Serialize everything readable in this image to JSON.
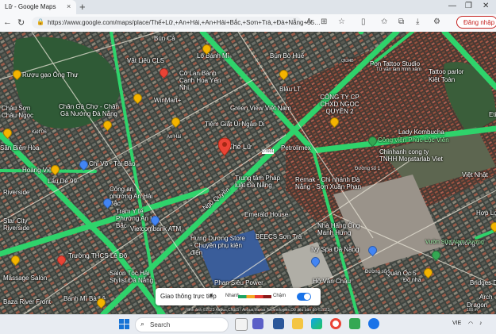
{
  "browser": {
    "tab_title": "Lữ - Google Maps",
    "tab_close": "×",
    "new_tab": "+",
    "url": "https://www.google.com/maps/place/Thế+Lữ,+An+Hải,+An+Hải+Bắc,+Sơn+Trà,+Đà+Nẵng+55…",
    "login_label": "Đăng nhập",
    "window_controls": [
      "—",
      "❐",
      "✕"
    ]
  },
  "map": {
    "labels": [
      {
        "id": "bun-ca",
        "text": "Bún Cá"
      },
      {
        "id": "vatlieu",
        "text": "Vật Liệu CLS"
      },
      {
        "id": "lo-banh-mi",
        "text": "Lò Bánh Mì"
      },
      {
        "id": "bun-bo",
        "text": "Bún Bò Huế"
      },
      {
        "id": "ruou-gao",
        "text": "Rượu gạo Ông Thự"
      },
      {
        "id": "co-lan",
        "text": "Cô Lan Bánh Canh Hoa Yến Nhi"
      },
      {
        "id": "tk43",
        "text": "TK43"
      },
      {
        "id": "pon-tattoo",
        "text": "Pon Tattoo Studio"
      },
      {
        "id": "tattoo-sub",
        "text": "Tư vấn làm hình xăm"
      },
      {
        "id": "tattoo-parlor",
        "text": "Tattoo parlor"
      },
      {
        "id": "kiet-toan",
        "text": "Kiệt Toàn"
      },
      {
        "id": "chau-son",
        "text": "Châu Sơn Châu Ngọc"
      },
      {
        "id": "winmart",
        "text": "WinMart+"
      },
      {
        "id": "blau-lt",
        "text": "Blâu LT"
      },
      {
        "id": "chan-ga",
        "text": "Chân Gà Chợ - Chân Gà Nướng Đà Nẵng"
      },
      {
        "id": "green-view",
        "text": "Green View Việt Nam"
      },
      {
        "id": "cong-ty",
        "text": "CÔNG TY CP CHXD NGỌC QUYỀN 2"
      },
      {
        "id": "eti",
        "text": "Eti"
      },
      {
        "id": "tiem-giat",
        "text": "Tiệm Giặt Ủi Ngân Di"
      },
      {
        "id": "lady-kombucha",
        "text": "Lady Kombucha"
      },
      {
        "id": "san-bien",
        "text": "Sân Biên Hòa"
      },
      {
        "id": "the-lu",
        "text": "Thế Lữ"
      },
      {
        "id": "petrolimex",
        "text": "Petrolimex"
      },
      {
        "id": "cong-vien",
        "text": "Công viên Phúc Lộc Viên"
      },
      {
        "id": "chinhanh",
        "text": "Chinhanh cong ty TNHH Monstarlab Viet"
      },
      {
        "id": "hoang-viet",
        "text": "Hoàng Việt"
      },
      {
        "id": "chi-vo",
        "text": "Chi Võ - Tài Bảo"
      },
      {
        "id": "duong-so-1",
        "text": "Đường số 1"
      },
      {
        "id": "remak",
        "text": "Remak - Chi nhánh Đà Nẵng - Sơn Xuân Phan"
      },
      {
        "id": "viet-nhat",
        "text": "Việt Nhật"
      },
      {
        "id": "lau-de",
        "text": "Lẩu Dê 99"
      },
      {
        "id": "trung-tam",
        "text": "Trung tâm Pháp luật Đà Nẵng"
      },
      {
        "id": "riverside",
        "text": "Riverside"
      },
      {
        "id": "cong-an",
        "text": "Công an phường An Hải Bắc"
      },
      {
        "id": "tram-y-te",
        "text": "Trạm Y tế Phường An Hải Bắc"
      },
      {
        "id": "vietcombank",
        "text": "Vietcombank ATM"
      },
      {
        "id": "emerald",
        "text": "Emerald House"
      },
      {
        "id": "hopl",
        "text": "Hợp Lợi"
      },
      {
        "id": "city-riverside",
        "text": "Star City Riverside"
      },
      {
        "id": "nhat-hung",
        "text": "Nhà Hàng Ông Manh Hưng"
      },
      {
        "id": "hung-duong",
        "text": "Hưng Dương Store - Chuyên phụ kiện điện"
      },
      {
        "id": "beecs",
        "text": "BEECS Sơn Trà"
      },
      {
        "id": "ivy-spa",
        "text": "Ivy Spa Đà Nẵng"
      },
      {
        "id": "truong-thcs",
        "text": "Trường THCS Lê Độ"
      },
      {
        "id": "van-phong",
        "text": "Văn phòng"
      },
      {
        "id": "salon",
        "text": "Salon Tóc Hải Stylist Đà Nẵng"
      },
      {
        "id": "phan-sieu",
        "text": "Phan Siêu Power"
      },
      {
        "id": "duong-so-5",
        "text": "Đường số 5"
      },
      {
        "id": "massage",
        "text": "Massage Salon"
      },
      {
        "id": "ho-van",
        "text": "Hồ Văn Châu"
      },
      {
        "id": "quan-oc",
        "text": "Quán Ốc 5"
      },
      {
        "id": "do-nha",
        "text": "Đồ nha"
      },
      {
        "id": "bridges",
        "text": "Bridges D"
      },
      {
        "id": "ngo-quyen",
        "text": "Ngô Quyền"
      },
      {
        "id": "baza",
        "text": "Baza River Front"
      },
      {
        "id": "banh-mi-ba-le",
        "text": "Bánh Mì Bà Lê"
      },
      {
        "id": "greenview-rd",
        "text": "Vườn Sữa Nam Dương"
      },
      {
        "id": "arch",
        "text": "Arch"
      },
      {
        "id": "dragon",
        "text": "Dragon"
      },
      {
        "id": "dt599",
        "text": "QL14B"
      },
      {
        "id": "dt599b",
        "text": "DT601"
      },
      {
        "id": "an-hai",
        "text": "An Hải"
      },
      {
        "id": "kiet",
        "text": "Kiệt 06"
      }
    ],
    "traffic": {
      "label": "Giao thông trực tiếp",
      "caret": "▾",
      "fast": "Nhanh",
      "slow": "Chậm",
      "legend_colors": [
        "#1ea362",
        "#f5a623",
        "#e53935",
        "#8b1a1a"
      ],
      "toggle_on": true
    },
    "attribution": "Hình ảnh ©2023 Airbus,CNES / Airbus,Maxar Technologies,Dữ liệu bản đồ ©2023",
    "scale": "100 m"
  },
  "taskbar": {
    "search_placeholder": "Search",
    "language": "VIE",
    "apps": [
      "start-icon",
      "search",
      "widgets-icon",
      "chat-icon",
      "teams-icon",
      "word-icon",
      "folder-icon",
      "edge-icon",
      "chrome-icon",
      "maps-icon",
      "zalo-icon"
    ]
  },
  "colors": {
    "road_traffic": "#2fd36b",
    "login_accent": "#c5221f",
    "toggle": "#1a73e8",
    "pin_orange": "#f4b400",
    "pin_red": "#ea4335",
    "pin_blue": "#4285f4",
    "pin_green": "#34a853"
  }
}
